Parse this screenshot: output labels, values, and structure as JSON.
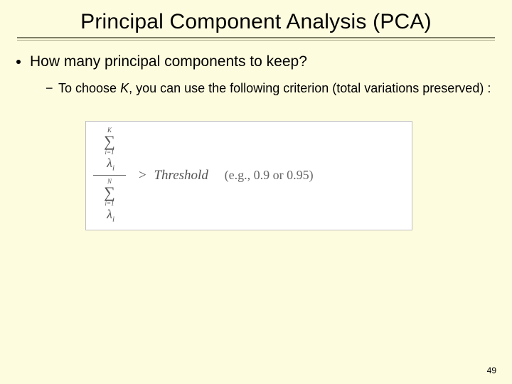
{
  "title": "Principal Component Analysis (PCA)",
  "bullets": {
    "level1": "How many principal components to keep?",
    "level2_a": "To choose ",
    "level2_k": "K",
    "level2_b": ", you can use the following criterion (total variations preserved) :"
  },
  "formula": {
    "num_upper": "K",
    "num_lower": "i=1",
    "den_upper": "N",
    "den_lower": "i=1",
    "sigma": "∑",
    "lambda": "λ",
    "sub": "i",
    "gt": ">",
    "threshold": "Threshold",
    "example": "(e.g., 0.9 or 0.95)"
  },
  "page": "49"
}
